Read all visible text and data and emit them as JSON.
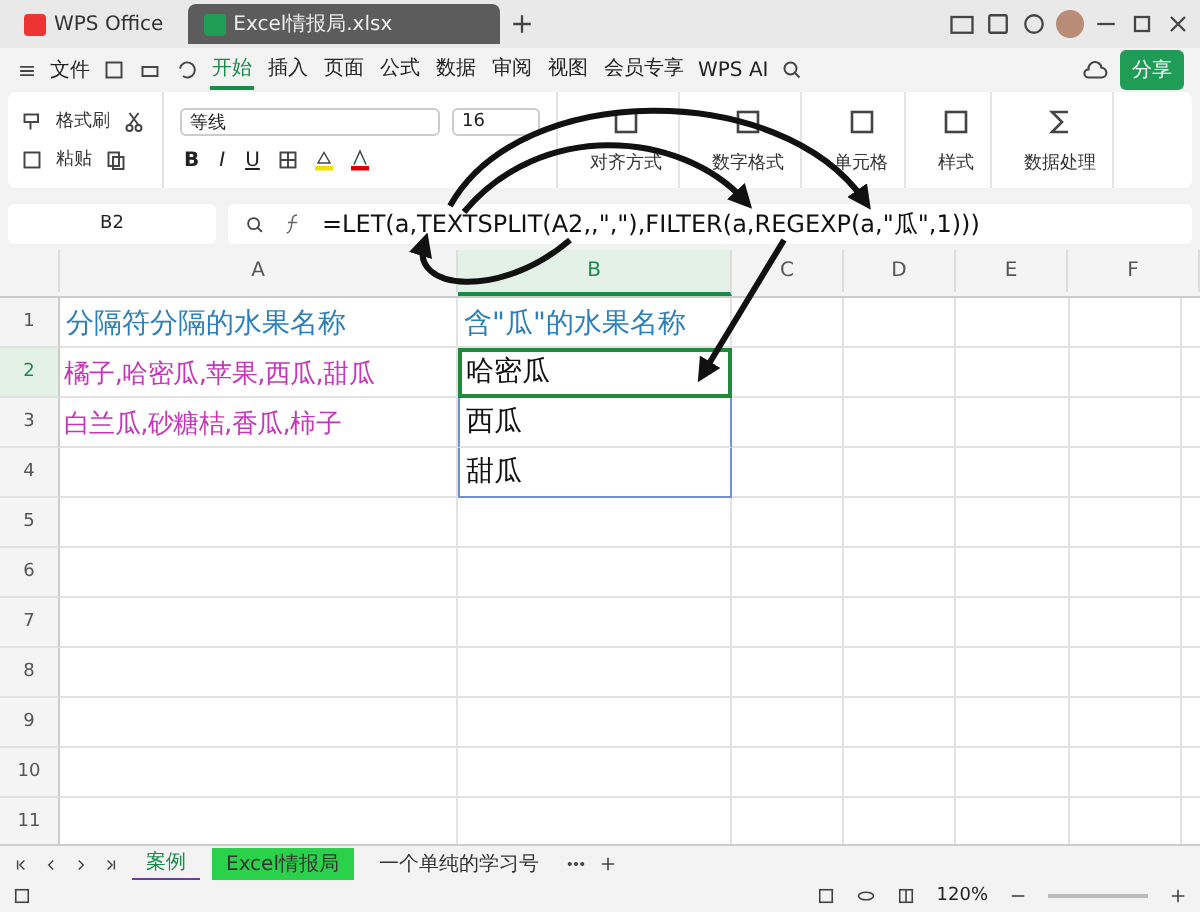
{
  "tabs": [
    {
      "label": "WPS Office",
      "selected": false,
      "kind": "home"
    },
    {
      "label": "Excel情报局.xlsx",
      "selected": true,
      "kind": "file"
    }
  ],
  "menu": {
    "file": "文件",
    "items": [
      {
        "label": "开始",
        "selected": true
      },
      {
        "label": "插入",
        "selected": false
      },
      {
        "label": "页面",
        "selected": false
      },
      {
        "label": "公式",
        "selected": false
      },
      {
        "label": "数据",
        "selected": false
      },
      {
        "label": "审阅",
        "selected": false
      },
      {
        "label": "视图",
        "selected": false
      },
      {
        "label": "会员专享",
        "selected": false
      }
    ],
    "ai": "WPS AI",
    "share": "分享"
  },
  "ribbon": {
    "format_painter": "格式刷",
    "paste": "粘贴",
    "font": "等线",
    "size": "16",
    "format_buttons": [
      "B",
      "I",
      "U"
    ],
    "groups": [
      "对齐方式",
      "数字格式",
      "单元格",
      "样式",
      "数据处理"
    ]
  },
  "formula_bar": {
    "cell": "B2",
    "formula": "=LET(a,TEXTSPLIT(A2,,\",\"),FILTER(a,REGEXP(a,\"瓜\",1)))"
  },
  "columns": [
    {
      "label": "A",
      "selected": false
    },
    {
      "label": "B",
      "selected": true
    },
    {
      "label": "C",
      "selected": false
    },
    {
      "label": "D",
      "selected": false
    },
    {
      "label": "E",
      "selected": false
    },
    {
      "label": "F",
      "selected": false
    }
  ],
  "rows": [
    {
      "number": "1",
      "cells": [
        {
          "text": "分隔符分隔的水果名称",
          "kind": "heading"
        },
        {
          "text": "含\"瓜\"的水果名称",
          "kind": "heading"
        }
      ]
    },
    {
      "number": "2",
      "selected": true,
      "cells": [
        {
          "text": "橘子,哈密瓜,苹果,西瓜,甜瓜",
          "kind": "source"
        },
        {
          "text": "哈密瓜",
          "kind": "result",
          "selected": true
        }
      ]
    },
    {
      "number": "3",
      "selected": false,
      "cells": [
        {
          "text": "白兰瓜,砂糖桔,香瓜,柿子",
          "kind": "source"
        },
        {
          "text": "西瓜",
          "kind": "result",
          "selected": false
        }
      ]
    },
    {
      "number": "4",
      "cells": [
        {},
        {
          "text": "甜瓜",
          "kind": "result",
          "selected": false
        }
      ]
    },
    {
      "number": "5"
    },
    {
      "number": "6"
    },
    {
      "number": "7"
    },
    {
      "number": "8"
    },
    {
      "number": "9"
    },
    {
      "number": "10"
    },
    {
      "number": "11"
    }
  ],
  "sheets": [
    {
      "label": "案例",
      "selected": true,
      "kind": "plain"
    },
    {
      "label": "Excel情报局",
      "selected": false,
      "kind": "highlight"
    },
    {
      "label": "一个单纯的学习号",
      "selected": false,
      "kind": "plain"
    }
  ],
  "zoom": "120%"
}
